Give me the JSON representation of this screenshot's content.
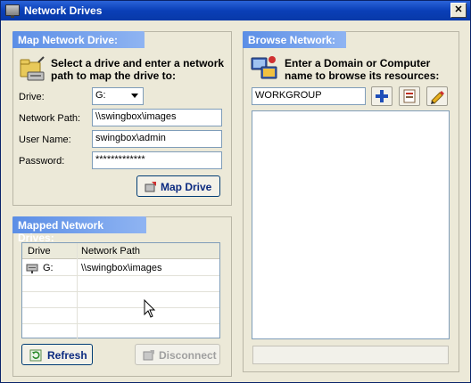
{
  "window": {
    "title": "Network Drives",
    "close_glyph": "✕"
  },
  "map_panel": {
    "header": "Map Network Drive:",
    "description": [
      "Select a drive and enter a network",
      "path to map the drive to:"
    ],
    "drive_label": "Drive:",
    "drive_value": "G:",
    "path_label": "Network Path:",
    "path_value": "\\\\swingbox\\images",
    "user_label": "User Name:",
    "user_value": "swingbox\\admin",
    "password_label": "Password:",
    "password_value": "*************",
    "map_button": "Map Drive"
  },
  "mapped_panel": {
    "header": "Mapped Network Drives:",
    "columns": [
      "Drive",
      "Network Path"
    ],
    "rows": [
      {
        "drive": "G:",
        "path": "\\\\swingbox\\images"
      }
    ],
    "refresh_button": "Refresh",
    "disconnect_button": "Disconnect"
  },
  "browse_panel": {
    "header": "Browse Network:",
    "description": [
      "Enter a Domain or Computer",
      "name to browse its resources:"
    ],
    "domain_value": "WORKGROUP"
  },
  "colors": {
    "title_bar": "#0a3fb7",
    "panel_header": "#5b8ee6",
    "accent_button_text": "#0b2a80"
  },
  "icons": [
    "network-drive-icon",
    "folder-network-icon",
    "browse-network-icon",
    "add-icon",
    "properties-icon",
    "pencil-icon",
    "refresh-icon",
    "disconnect-icon",
    "map-drive-icon"
  ]
}
